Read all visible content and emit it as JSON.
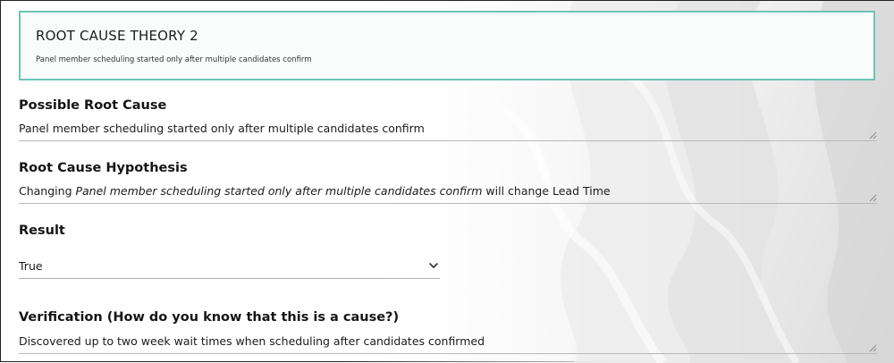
{
  "theory": {
    "title": "ROOT CAUSE THEORY 2",
    "subtitle": "Panel member scheduling started only after multiple candidates confirm"
  },
  "possible_root_cause": {
    "label": "Possible Root Cause",
    "value": "Panel member scheduling started only after multiple candidates confirm"
  },
  "hypothesis": {
    "label": "Root Cause Hypothesis",
    "prefix": "Changing ",
    "emphasis": "Panel member scheduling started only after multiple candidates confirm",
    "suffix": " will change Lead Time"
  },
  "result": {
    "label": "Result",
    "selected": "True"
  },
  "verification": {
    "label": "Verification (How do you know that this is a cause?)",
    "value": "Discovered up to two week wait times when scheduling after candidates confirmed"
  },
  "colors": {
    "card_border": "#6cc4b7",
    "background": "#ffffff"
  },
  "icons": {
    "select": "chevron-down-icon",
    "resize": "resize-grip-icon"
  }
}
